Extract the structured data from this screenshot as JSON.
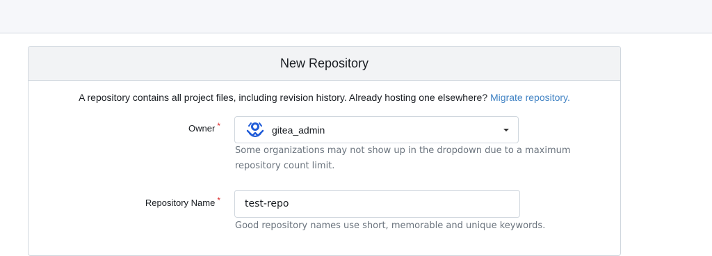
{
  "header": {
    "title": "New Repository"
  },
  "intro": {
    "text": "A repository contains all project files, including revision history. Already hosting one elsewhere? ",
    "link_label": "Migrate repository."
  },
  "owner": {
    "label": "Owner",
    "required_mark": "*",
    "selected_value": "gitea_admin",
    "help_text": "Some organizations may not show up in the dropdown due to a maximum repository count limit.",
    "avatar_icon": "gitea-logo-icon",
    "dropdown_icon": "caret-down-icon"
  },
  "repo_name": {
    "label": "Repository Name",
    "required_mark": "*",
    "value": "test-repo",
    "help_text": "Good repository names use short, memorable and unique keywords."
  },
  "colors": {
    "link": "#4183c4",
    "required": "#db2828",
    "help_text": "#6a737d",
    "border": "#d0d7de",
    "header_bg": "#f2f3f5",
    "topbar_bg": "#f6f7fa"
  }
}
